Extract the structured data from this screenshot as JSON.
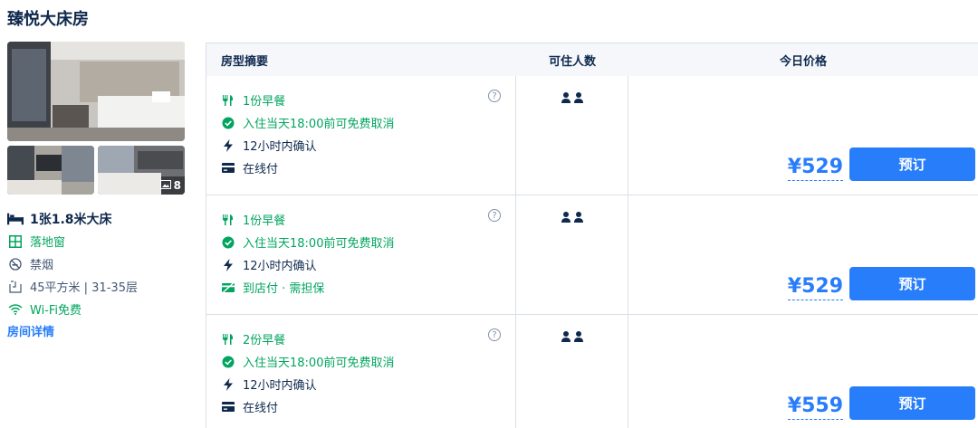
{
  "room": {
    "title": "臻悦大床房",
    "photo_count": "8",
    "bed": "1张1.8米大床",
    "window": "落地窗",
    "smoking": "禁烟",
    "area_floor": "45平方米 | 31-35层",
    "wifi": "Wi-Fi免费",
    "details_link": "房间详情"
  },
  "table": {
    "headers": {
      "summary": "房型摘要",
      "guests": "可住人数",
      "price": "今日价格"
    }
  },
  "offers": [
    {
      "breakfast": "1份早餐",
      "cancel": "入住当天18:00前可免费取消",
      "confirm": "12小时内确认",
      "payment": "在线付",
      "payment_type": "online",
      "price": "¥529",
      "book_label": "预订",
      "help": "?"
    },
    {
      "breakfast": "1份早餐",
      "cancel": "入住当天18:00前可免费取消",
      "confirm": "12小时内确认",
      "payment": "到店付 · 需担保",
      "payment_type": "hotel",
      "price": "¥529",
      "book_label": "预订",
      "help": "?"
    },
    {
      "breakfast": "2份早餐",
      "cancel": "入住当天18:00前可免费取消",
      "confirm": "12小时内确认",
      "payment": "在线付",
      "payment_type": "online",
      "price": "¥559",
      "book_label": "预订",
      "help": "?"
    }
  ],
  "colors": {
    "accent": "#287dfa",
    "green": "#00a55f",
    "text": "#0f294d"
  }
}
